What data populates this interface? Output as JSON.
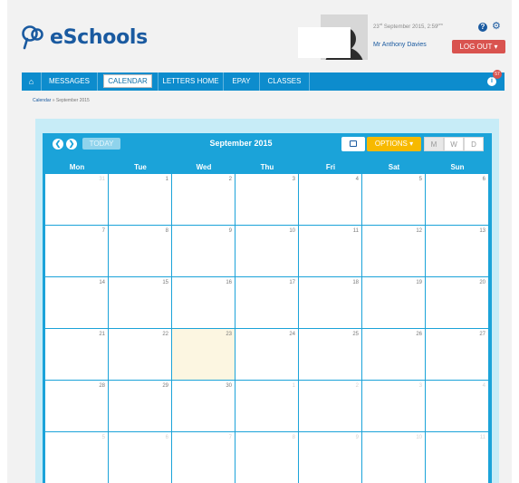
{
  "brand": {
    "logo_text": "eSchools"
  },
  "header": {
    "date_day": "23",
    "date_suffix": "rd",
    "date_rest": "September 2015, 2:59",
    "date_ampm": "pm",
    "user_name": "Mr Anthony Davies",
    "logout_label": "LOG OUT ▾",
    "help_icon": "?",
    "gear_icon": "⚙"
  },
  "nav": {
    "home_icon": "⌂",
    "items": [
      "MESSAGES",
      "CALENDAR",
      "LETTERS HOME",
      "EPAY",
      "CLASSES"
    ],
    "active": "CALENDAR",
    "info_icon": "i",
    "notification_count": "57"
  },
  "breadcrumb": {
    "root": "Calendar",
    "separator": "»",
    "current": "September 2015"
  },
  "calendar": {
    "today_label": "TODAY",
    "title": "September 2015",
    "options_label": "OPTIONS ▾",
    "views": [
      "M",
      "W",
      "D"
    ],
    "active_view": "M",
    "weekdays": [
      "Mon",
      "Tue",
      "Wed",
      "Thu",
      "Fri",
      "Sat",
      "Sun"
    ],
    "weeks": [
      [
        "31",
        "1",
        "2",
        "3",
        "4",
        "5",
        "6"
      ],
      [
        "7",
        "8",
        "9",
        "10",
        "11",
        "12",
        "13"
      ],
      [
        "14",
        "15",
        "16",
        "17",
        "18",
        "19",
        "20"
      ],
      [
        "21",
        "22",
        "23",
        "24",
        "25",
        "26",
        "27"
      ],
      [
        "28",
        "29",
        "30",
        "1",
        "2",
        "3",
        "4"
      ],
      [
        "5",
        "6",
        "7",
        "8",
        "9",
        "10",
        "11"
      ]
    ],
    "today_date": "23",
    "colors": {
      "frame": "#1ba3d9",
      "today_bg": "#fcf6e1",
      "options": "#f7b900",
      "logout": "#d9534f",
      "brand": "#1a5aa0"
    }
  }
}
